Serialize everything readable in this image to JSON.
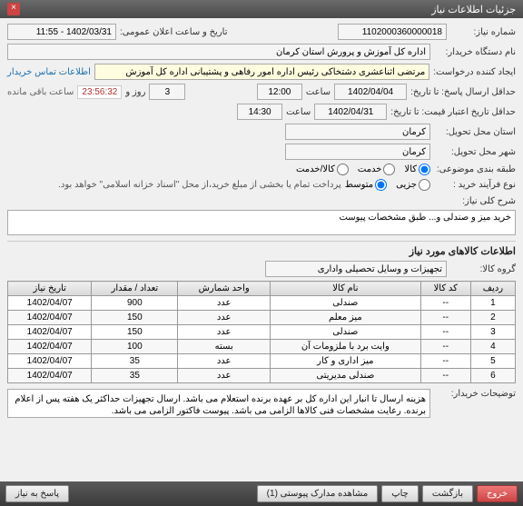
{
  "title_bar": {
    "title": "جزئیات اطلاعات نیاز"
  },
  "header": {
    "need_no_label": "شماره نیاز:",
    "need_no": "1102000360000018",
    "announce_label": "تاریخ و ساعت اعلان عمومی:",
    "announce_value": "1402/03/31 - 11:55",
    "buyer_org_label": "نام دستگاه خریدار:",
    "buyer_org": "اداره کل آموزش و پرورش استان کرمان",
    "requester_label": "ایجاد کننده درخواست:",
    "requester": "مرتضی اثناعشری دشتخاکی رئیس اداره امور رفاهی و پشتیبانی اداره کل آموزش",
    "contact_link": "اطلاعات تماس خریدار"
  },
  "deadlines": {
    "resp_deadline_label": "حداقل ارسال پاسخ: تا تاریخ:",
    "resp_date": "1402/04/04",
    "time_label": "ساعت",
    "resp_time": "12:00",
    "days_label": "روز و",
    "days": "3",
    "countdown": "23:56:32",
    "remain": "ساعت باقی مانده",
    "valid_deadline_label": "حداقل تاریخ اعتبار قیمت: تا تاریخ:",
    "valid_date": "1402/04/31",
    "valid_time": "14:30"
  },
  "location": {
    "deliver_prov_label": "استان محل تحویل:",
    "deliver_prov": "کرمان",
    "deliver_city_label": "شهر محل تحویل:",
    "deliver_city": "کرمان"
  },
  "classify": {
    "subject_label": "طبقه بندی موضوعی:",
    "opts": {
      "goods": "کالا",
      "service": "خدمت",
      "goods_service": "کالا/خدمت"
    },
    "selected_subject": "goods",
    "process_label": "نوع فرآیند خرید :",
    "proc_opts": {
      "small": "جزیی",
      "medium": "متوسط"
    },
    "selected_proc": "medium",
    "proc_note": "پرداخت تمام یا بخشی از مبلغ خرید،از محل \"اسناد خزانه اسلامی\" خواهد بود."
  },
  "need_summary": {
    "label": "شرح کلی نیاز:",
    "text": "خرید میز و صندلی و... طبق مشخصات پیوست"
  },
  "goods_section": {
    "title": "اطلاعات کالاهای مورد نیاز",
    "group_label": "گروه کالا:",
    "group": "تجهیزات و وسایل تحصیلی واداری"
  },
  "table": {
    "cols": [
      "ردیف",
      "کد کالا",
      "نام کالا",
      "واحد شمارش",
      "تعداد / مقدار",
      "تاریخ نیاز"
    ],
    "rows": [
      {
        "idx": "1",
        "code": "--",
        "name": "صندلی",
        "unit": "عدد",
        "qty": "900",
        "date": "1402/04/07"
      },
      {
        "idx": "2",
        "code": "--",
        "name": "میز معلم",
        "unit": "عدد",
        "qty": "150",
        "date": "1402/04/07"
      },
      {
        "idx": "3",
        "code": "--",
        "name": "صندلی",
        "unit": "عدد",
        "qty": "150",
        "date": "1402/04/07"
      },
      {
        "idx": "4",
        "code": "--",
        "name": "وایت برد با ملزومات آن",
        "unit": "بسته",
        "qty": "100",
        "date": "1402/04/07"
      },
      {
        "idx": "5",
        "code": "--",
        "name": "میز اداری و کار",
        "unit": "عدد",
        "qty": "35",
        "date": "1402/04/07"
      },
      {
        "idx": "6",
        "code": "--",
        "name": "صندلی مدیریتی",
        "unit": "عدد",
        "qty": "35",
        "date": "1402/04/07"
      }
    ]
  },
  "buyer_desc": {
    "label": "توضیحات خریدار:",
    "text": "هزینه ارسال تا انبار این اداره کل بر عهده برنده استعلام می باشد. ارسال تجهیزات حداکثر یک هفته پس از اعلام برنده. رعایت مشخصات فنی کالاها الزامی می باشد. پیوست فاکتور الزامی می باشد."
  },
  "buttons": {
    "exit": "خروج",
    "return": "بازگشت",
    "print": "چاپ",
    "view_attach": "مشاهده مدارک پیوستی (1)",
    "reply": "پاسخ به نیاز"
  }
}
